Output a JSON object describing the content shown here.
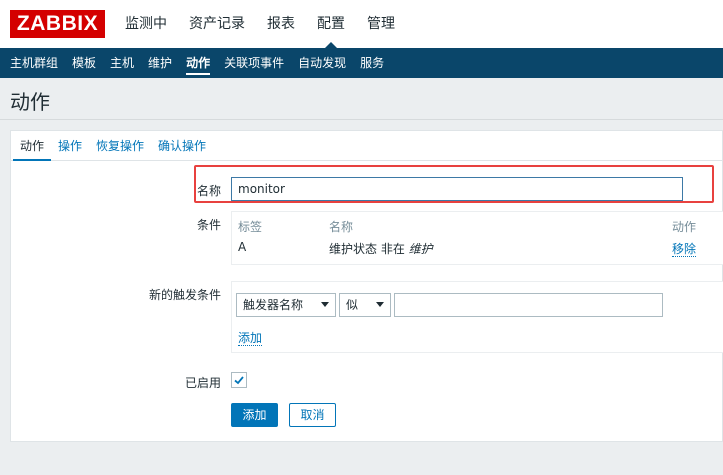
{
  "app": {
    "logo_text": "ZABBIX",
    "accent_color": "#0a466a",
    "logo_color": "#d40000"
  },
  "topnav": {
    "items": [
      {
        "label": "监测中"
      },
      {
        "label": "资产记录"
      },
      {
        "label": "报表"
      },
      {
        "label": "配置",
        "active": true
      },
      {
        "label": "管理"
      }
    ]
  },
  "subnav": {
    "items": [
      {
        "label": "主机群组"
      },
      {
        "label": "模板"
      },
      {
        "label": "主机"
      },
      {
        "label": "维护"
      },
      {
        "label": "动作",
        "active": true
      },
      {
        "label": "关联项事件"
      },
      {
        "label": "自动发现"
      },
      {
        "label": "服务"
      }
    ]
  },
  "page": {
    "title": "动作"
  },
  "tabs": [
    {
      "label": "动作",
      "active": true
    },
    {
      "label": "操作"
    },
    {
      "label": "恢复操作"
    },
    {
      "label": "确认操作"
    }
  ],
  "form": {
    "name_label": "名称",
    "name_value": "monitor",
    "conditions_label": "条件",
    "conditions": {
      "headers": {
        "tag": "标签",
        "name": "名称",
        "action": "动作"
      },
      "rows": [
        {
          "tag": "A",
          "name_prefix": "维护状态 非在",
          "name_italic": "维护",
          "action": "移除"
        }
      ]
    },
    "new_condition_label": "新的触发条件",
    "new_condition": {
      "type_select": "触发器名称",
      "operator_select": "似",
      "value": "",
      "add_link": "添加"
    },
    "enabled_label": "已启用",
    "enabled": true,
    "add_button": "添加",
    "cancel_button": "取消"
  }
}
